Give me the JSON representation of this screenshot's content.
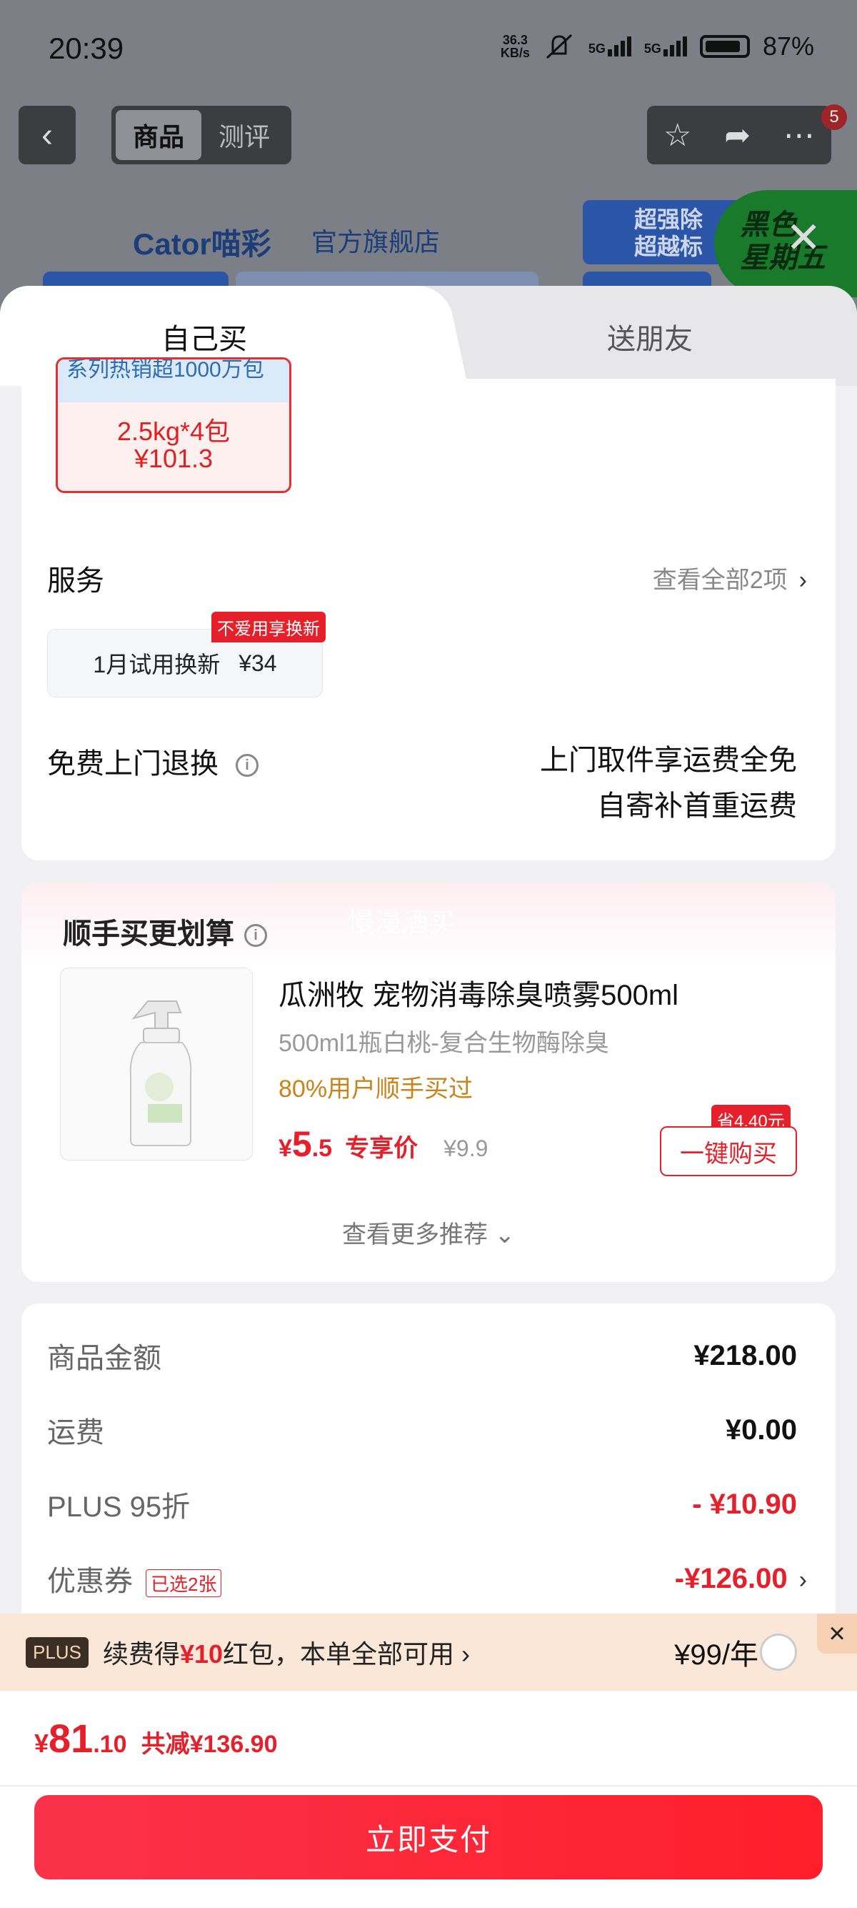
{
  "status_bar": {
    "time": "20:39",
    "net_speed_top": "36.3",
    "net_speed_bottom": "KB/s",
    "signal1": "5G",
    "signal2": "5G",
    "battery": "87%"
  },
  "header": {
    "tabs": [
      "商品",
      "测评"
    ],
    "badge": "5"
  },
  "background": {
    "shop_logo": "Cator喵彩",
    "shop_name": "官方旗舰店",
    "promo_line1": "超强除",
    "promo_line2": "超越标",
    "black_friday_line1": "黑色",
    "black_friday_line2": "星期五"
  },
  "sheet_tabs": {
    "self": "自己买",
    "friend": "送朋友"
  },
  "sku": {
    "banner": "系列热销超1000万包",
    "spec": "2.5kg*4包",
    "price": "¥101.3"
  },
  "service": {
    "title": "服务",
    "view_all": "查看全部2项",
    "item_label": "1月试用换新",
    "item_price": "¥34",
    "item_tag": "不爱用享换新"
  },
  "free_return": {
    "title": "免费上门退换",
    "line1": "上门取件享运费全免",
    "line2": "自寄补首重运费"
  },
  "recommend": {
    "title": "顺手买更划算",
    "watermark": "慢漫酒买",
    "product_name": "瓜洲牧 宠物消毒除臭喷雾500ml",
    "product_spec": "500ml1瓶白桃-复合生物酶除臭",
    "buyers": "80%用户顺手买过",
    "price_symbol": "¥",
    "price_int": "5",
    "price_dec": ".5",
    "price_label": "专享价",
    "original_price": "¥9.9",
    "save_tag": "省4.40元",
    "buy_button": "一键购买",
    "more": "查看更多推荐"
  },
  "summary": {
    "rows": [
      {
        "label": "商品金额",
        "value": "¥218.00"
      },
      {
        "label": "运费",
        "value": "¥0.00"
      },
      {
        "label": "PLUS 95折",
        "value": "- ¥10.90"
      },
      {
        "label": "优惠券",
        "value": "-¥126.00",
        "tag": "已选2张"
      }
    ]
  },
  "plus_bar": {
    "logo": "PLUS",
    "text_before": "续费得",
    "text_red": "¥10",
    "text_after": "红包，本单全部可用",
    "price": "¥99/年"
  },
  "footer": {
    "total_symbol": "¥",
    "total_int": "81",
    "total_dec": ".10",
    "saved": "共减¥136.90",
    "pay_button": "立即支付"
  }
}
